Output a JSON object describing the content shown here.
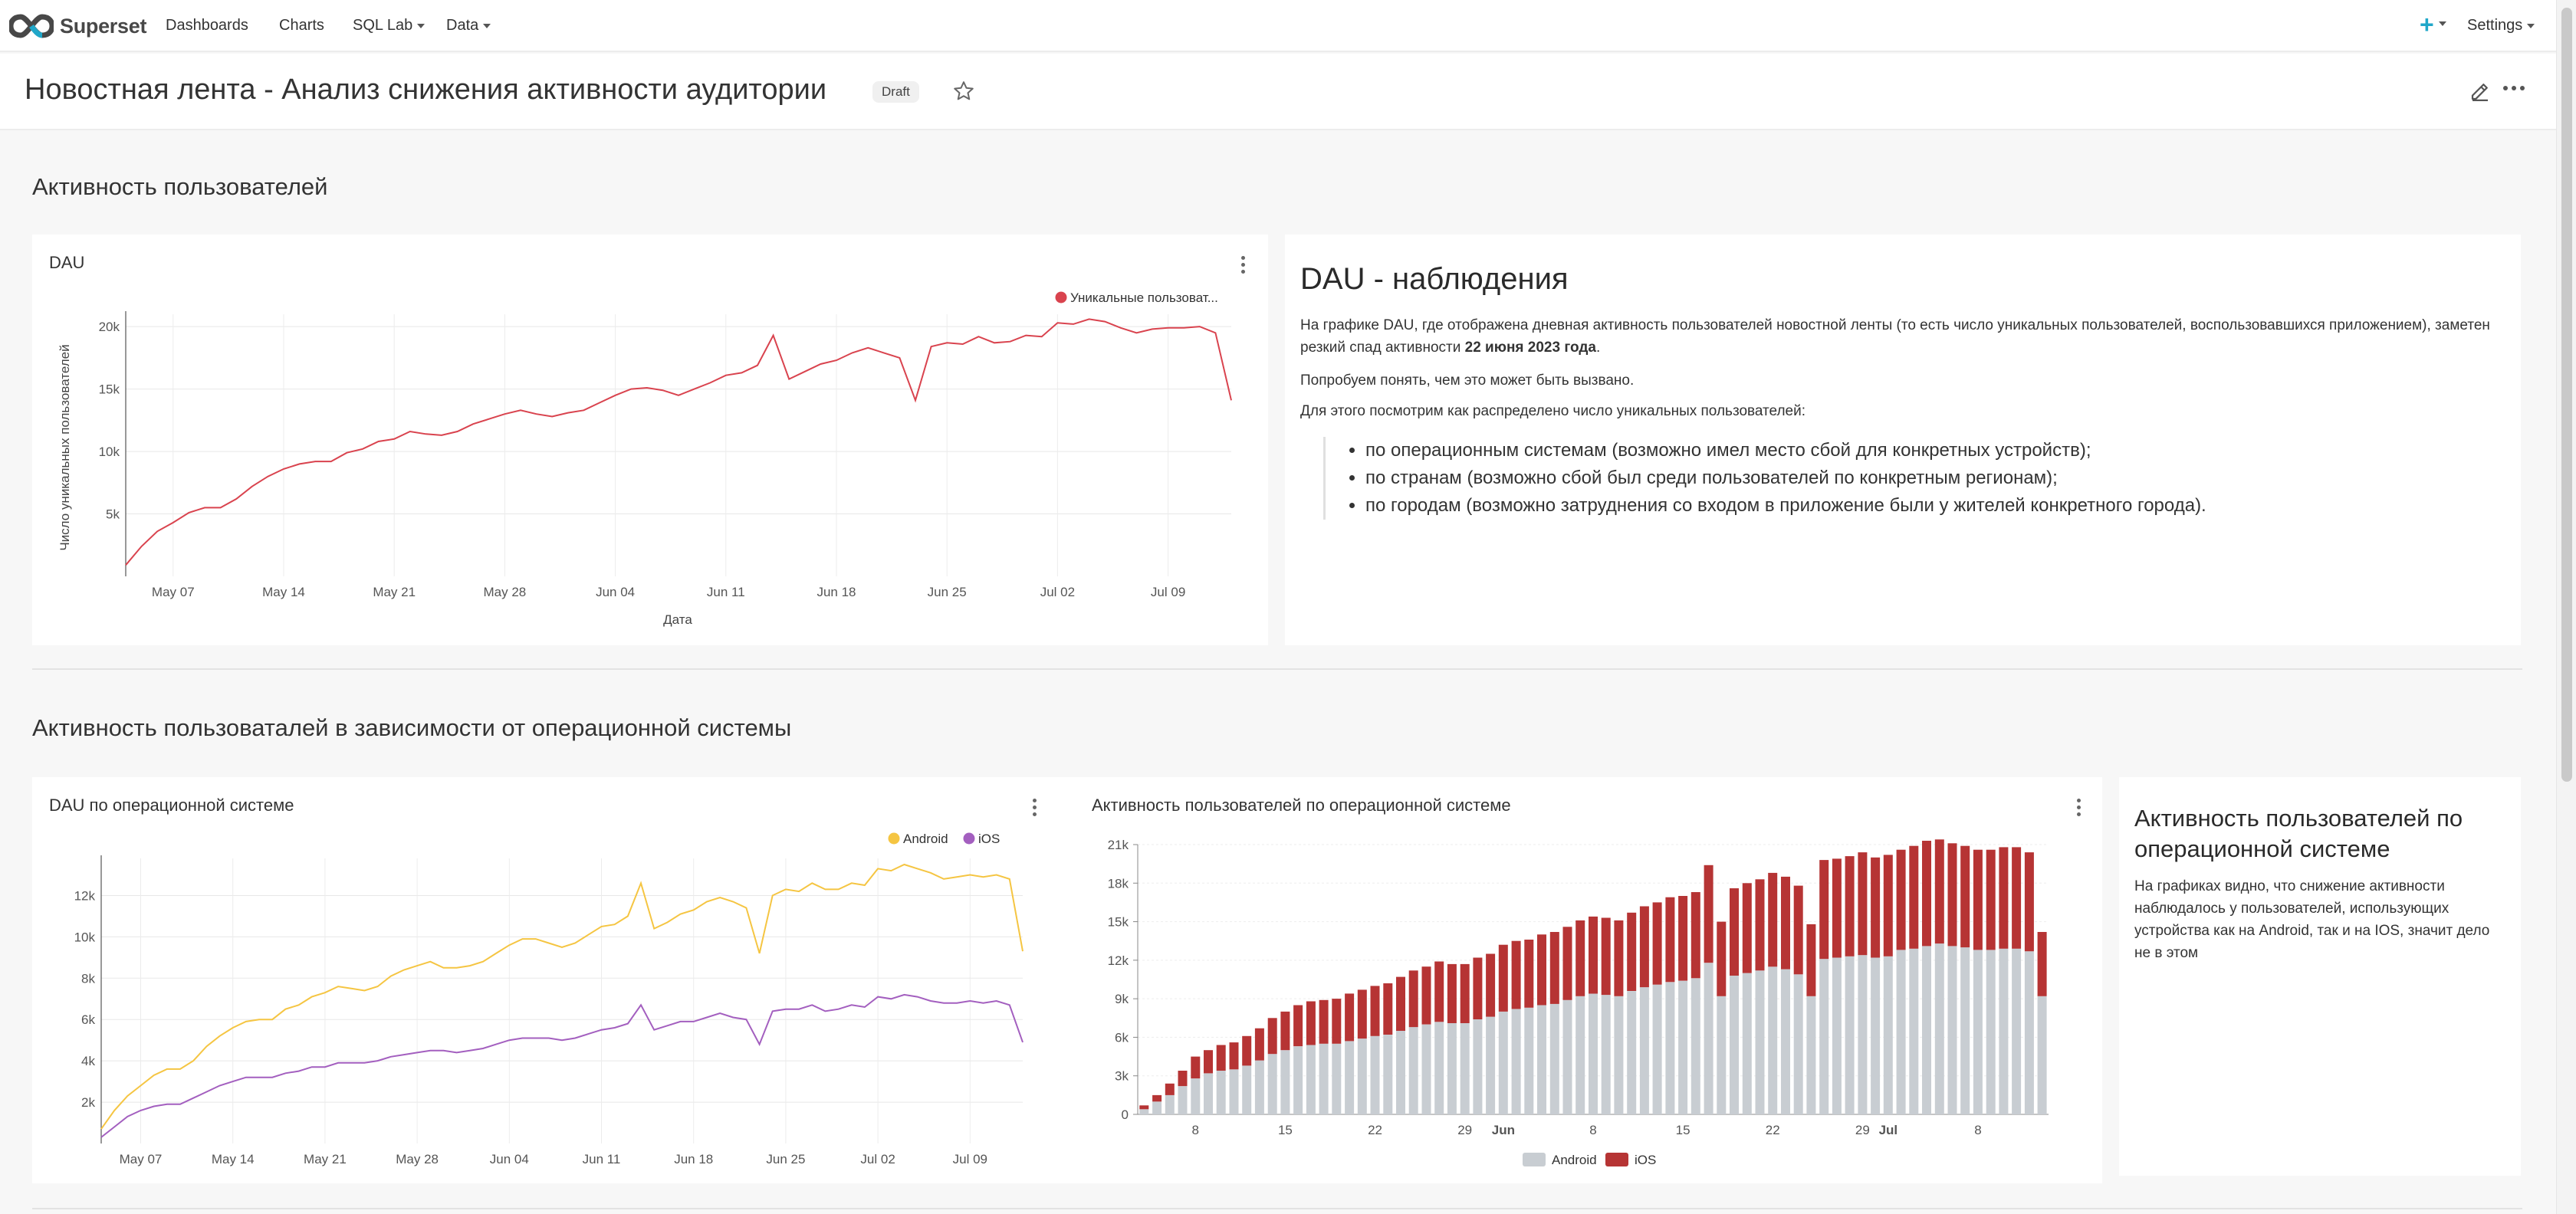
{
  "app": {
    "brand": "Superset",
    "nav": [
      {
        "label": "Dashboards",
        "has_caret": false
      },
      {
        "label": "Charts",
        "has_caret": false
      },
      {
        "label": "SQL Lab",
        "has_caret": true
      },
      {
        "label": "Data",
        "has_caret": true
      }
    ],
    "plus_label": "+",
    "settings_label": "Settings"
  },
  "dashboard": {
    "title": "Новостная лента - Анализ снижения активности аудитории",
    "status_badge": "Draft"
  },
  "sections": {
    "s1_title": "Активность пользователей",
    "s2_title": "Активность пользоваталей в зависимости от операционной системы"
  },
  "cards": {
    "dau_title": "DAU",
    "dau_os_title": "DAU по операционной системе",
    "bar_title": "Активность пользователей по операционной системе"
  },
  "markdown1": {
    "title": "DAU - наблюдения",
    "p1_a": "На графике DAU, где отображена дневная активность пользователей новостной ленты (то есть число уникальных пользователей, воспользовавшихся приложением), заметен резкий спад активности ",
    "p1_b": "22 июня 2023 года",
    "p1_c": ".",
    "p2": "Попробуем понять, чем это может быть вызвано.",
    "p3": "Для этого посмотрим как распределено число уникальных пользователей:",
    "list": [
      "по операционным системам (возможно имел место сбой для конкретных устройств);",
      "по странам (возможно сбой был среди пользователей по конкретным регионам);",
      "по городам (возможно затруднения со входом в приложение были у жителей конкретного города)."
    ]
  },
  "markdown2": {
    "title": "Активность пользователей по операционной системе",
    "text": "На графиках видно, что снижение активности наблюдалось у пользователей, использующих устройства как на Android, так и на IOS, значит дело не в этом"
  },
  "colors": {
    "dau_line": "#d9434e",
    "android": "#f5c542",
    "ios": "#a35fbf",
    "bar_android": "#c8cdd2",
    "bar_ios": "#b63434"
  },
  "chart_data": [
    {
      "type": "line",
      "title": "DAU",
      "xlabel": "Дата",
      "ylabel": "Число уникальных пользователей",
      "x_ticks": [
        "May 07",
        "May 14",
        "May 21",
        "May 28",
        "Jun 04",
        "Jun 11",
        "Jun 18",
        "Jun 25",
        "Jul 02",
        "Jul 09"
      ],
      "y_ticks": [
        "5k",
        "10k",
        "15k",
        "20k"
      ],
      "ylim": [
        0,
        20500
      ],
      "x_start": "2023-05-04",
      "series": [
        {
          "name": "Уникальные пользоват...",
          "values": [
            900,
            2400,
            3600,
            4300,
            5100,
            5500,
            5500,
            6200,
            7200,
            8000,
            8600,
            9000,
            9200,
            9200,
            9900,
            10200,
            10800,
            11000,
            11600,
            11400,
            11300,
            11600,
            12200,
            12600,
            13000,
            13300,
            13000,
            12800,
            13100,
            13300,
            13900,
            14500,
            15000,
            15100,
            14900,
            14500,
            15000,
            15500,
            16100,
            16300,
            16900,
            19300,
            15800,
            16400,
            17000,
            17300,
            17900,
            18300,
            17900,
            17500,
            14100,
            18400,
            18700,
            18600,
            19200,
            18700,
            18800,
            19300,
            19200,
            20300,
            20200,
            20600,
            20400,
            19900,
            19500,
            19800,
            19900,
            19900,
            20000,
            19500,
            14100
          ]
        }
      ],
      "legend": "top-right",
      "grid": true
    },
    {
      "type": "line",
      "title": "DAU по операционной системе",
      "x_ticks": [
        "May 07",
        "May 14",
        "May 21",
        "May 28",
        "Jun 04",
        "Jun 11",
        "Jun 18",
        "Jun 25",
        "Jul 02",
        "Jul 09"
      ],
      "y_ticks": [
        "2k",
        "4k",
        "6k",
        "8k",
        "10k",
        "12k"
      ],
      "ylim": [
        0,
        13500
      ],
      "x_start": "2023-05-04",
      "series": [
        {
          "name": "Android",
          "values": [
            700,
            1600,
            2300,
            2800,
            3300,
            3600,
            3600,
            4000,
            4700,
            5200,
            5600,
            5900,
            6000,
            6000,
            6500,
            6700,
            7100,
            7300,
            7600,
            7500,
            7400,
            7600,
            8100,
            8400,
            8600,
            8800,
            8500,
            8500,
            8600,
            8800,
            9200,
            9600,
            9900,
            9900,
            9700,
            9500,
            9700,
            10100,
            10500,
            10600,
            11000,
            12600,
            10400,
            10700,
            11100,
            11300,
            11700,
            11900,
            11700,
            11400,
            9200,
            12000,
            12300,
            12200,
            12600,
            12300,
            12300,
            12600,
            12500,
            13300,
            13200,
            13500,
            13300,
            13100,
            12800,
            12900,
            13000,
            12900,
            13000,
            12800,
            9300
          ]
        },
        {
          "name": "iOS",
          "values": [
            300,
            800,
            1300,
            1600,
            1800,
            1900,
            1900,
            2200,
            2500,
            2800,
            3000,
            3200,
            3200,
            3200,
            3400,
            3500,
            3700,
            3700,
            3900,
            3900,
            3900,
            4000,
            4200,
            4300,
            4400,
            4500,
            4500,
            4400,
            4500,
            4600,
            4800,
            5000,
            5100,
            5100,
            5100,
            5000,
            5100,
            5300,
            5500,
            5600,
            5800,
            6700,
            5500,
            5700,
            5900,
            5900,
            6100,
            6300,
            6100,
            6000,
            4800,
            6400,
            6500,
            6500,
            6700,
            6400,
            6500,
            6700,
            6600,
            7100,
            7000,
            7200,
            7100,
            6900,
            6800,
            6800,
            6900,
            6800,
            6900,
            6700,
            4900
          ]
        }
      ],
      "legend": "top-right",
      "grid": true
    },
    {
      "type": "bar",
      "stacked": true,
      "title": "Активность пользователей по операционной системе",
      "x_ticks": [
        {
          "label": "8",
          "bold": false
        },
        {
          "label": "15",
          "bold": false
        },
        {
          "label": "22",
          "bold": false
        },
        {
          "label": "29",
          "bold": false
        },
        {
          "label": "Jun",
          "bold": true
        },
        {
          "label": "8",
          "bold": false
        },
        {
          "label": "15",
          "bold": false
        },
        {
          "label": "22",
          "bold": false
        },
        {
          "label": "29",
          "bold": false
        },
        {
          "label": "Jul",
          "bold": true
        },
        {
          "label": "8",
          "bold": false
        }
      ],
      "y_ticks": [
        "0",
        "3k",
        "6k",
        "9k",
        "12k",
        "15k",
        "18k",
        "21k"
      ],
      "ylim": [
        0,
        21000
      ],
      "series": [
        {
          "name": "Android",
          "values": [
            400,
            1000,
            1500,
            2200,
            2800,
            3200,
            3400,
            3500,
            3800,
            4200,
            4700,
            5000,
            5300,
            5400,
            5500,
            5500,
            5700,
            5900,
            6100,
            6200,
            6500,
            6800,
            7000,
            7200,
            7100,
            7100,
            7400,
            7600,
            8000,
            8200,
            8300,
            8500,
            8600,
            8900,
            9200,
            9400,
            9300,
            9200,
            9600,
            9900,
            10100,
            10300,
            10400,
            10600,
            11800,
            9200,
            10800,
            11000,
            11200,
            11500,
            11300,
            10900,
            9200,
            12100,
            12200,
            12300,
            12400,
            12200,
            12300,
            12800,
            12900,
            13100,
            13300,
            13100,
            13000,
            12800,
            12800,
            12900,
            12900,
            12700,
            9200
          ]
        },
        {
          "name": "iOS",
          "values": [
            300,
            500,
            900,
            1200,
            1700,
            1800,
            2000,
            2100,
            2300,
            2500,
            2800,
            3000,
            3200,
            3400,
            3400,
            3500,
            3700,
            3800,
            3900,
            4000,
            4200,
            4400,
            4500,
            4700,
            4600,
            4600,
            4800,
            4900,
            5200,
            5300,
            5300,
            5500,
            5600,
            5700,
            5900,
            6000,
            6000,
            5900,
            6100,
            6300,
            6400,
            6600,
            6600,
            6700,
            7600,
            5800,
            6800,
            7000,
            7100,
            7300,
            7200,
            6900,
            5600,
            7700,
            7700,
            7800,
            8000,
            7800,
            7900,
            7800,
            8000,
            8200,
            8100,
            8000,
            7900,
            7800,
            7800,
            7900,
            7900,
            7700,
            5000
          ]
        }
      ],
      "legend": "bottom",
      "grid": true
    }
  ]
}
